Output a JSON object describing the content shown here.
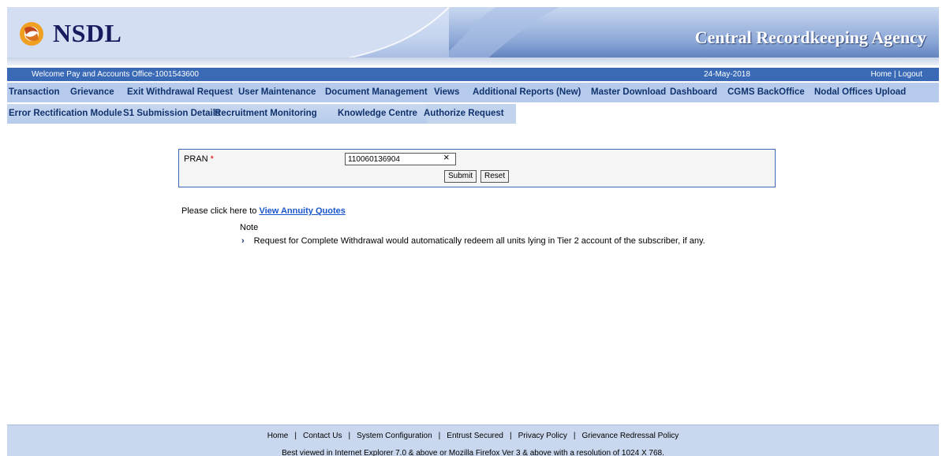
{
  "header": {
    "logo_text": "NSDL",
    "agency_title": "Central Recordkeeping Agency"
  },
  "welcome_bar": {
    "welcome_text": "Welcome Pay and Accounts Office-1001543600",
    "date": "24-May-2018",
    "home_link": "Home",
    "separator": " | ",
    "logout_link": "Logout"
  },
  "menu": {
    "row1": [
      {
        "label": "Transaction"
      },
      {
        "label": "Grievance"
      },
      {
        "label": "Exit Withdrawal Request"
      },
      {
        "label": "User Maintenance"
      },
      {
        "label": "Document Management"
      },
      {
        "label": "Views"
      },
      {
        "label": "Additional Reports (New)"
      },
      {
        "label": "Master Download"
      },
      {
        "label": "Dashboard"
      },
      {
        "label": "CGMS BackOffice"
      },
      {
        "label": "Nodal Offices Upload"
      }
    ],
    "row2": [
      {
        "label": "Error Rectification Module"
      },
      {
        "label": "S1 Submission Details"
      },
      {
        "label": "Recruitment Monitoring"
      },
      {
        "label": "Knowledge Centre"
      },
      {
        "label": "Authorize Request"
      }
    ]
  },
  "form": {
    "pran_label": "PRAN",
    "required_mark": "*",
    "pran_value": "110060136904",
    "clear_symbol": "×",
    "submit_label": "Submit",
    "reset_label": "Reset"
  },
  "annuity": {
    "prefix": "Please click here to ",
    "link_text": "View Annuity Quotes"
  },
  "note": {
    "title": "Note",
    "bullet": "›",
    "text": "Request for Complete Withdrawal would automatically redeem all units lying in Tier 2 account of the subscriber, if any."
  },
  "footer": {
    "links": [
      "Home",
      "Contact Us",
      "System Configuration",
      "Entrust Secured",
      "Privacy Policy",
      "Grievance Redressal Policy"
    ],
    "separator": "|",
    "best_viewed": "Best viewed in Internet Explorer 7.0 & above or Mozilla Firefox Ver 3 & above with a resolution of 1024 X 768."
  },
  "colors": {
    "nav_bar": "#3a69b6",
    "menu_bg": "#b6cbeb",
    "menu_text": "#10326e",
    "link": "#1a56c9",
    "required": "#e00000"
  },
  "icons": {
    "logo": "nsdl-logo-icon",
    "clear": "clear-icon",
    "bullet": "chevron-right-icon"
  }
}
